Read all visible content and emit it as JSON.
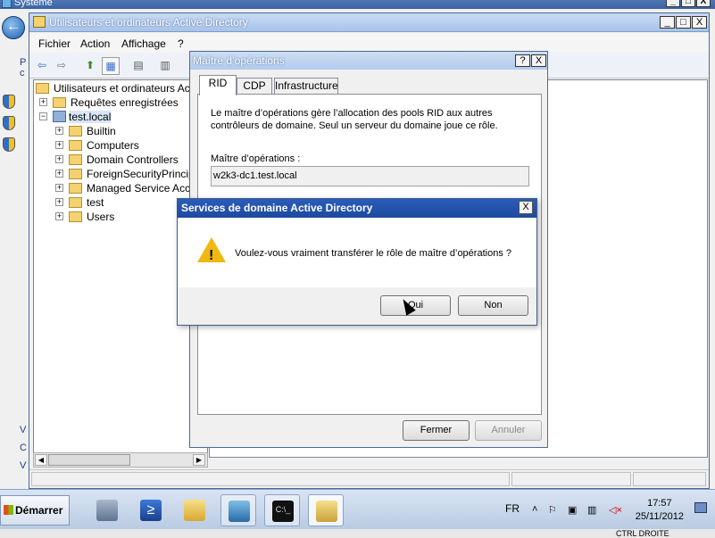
{
  "background_window": {
    "title": "Système",
    "side_chars": [
      "P",
      "c",
      "V",
      "C",
      "V"
    ],
    "controls": [
      "_",
      "□",
      "X"
    ]
  },
  "aduc": {
    "title": "Utilisateurs et ordinateurs Active Directory",
    "controls": [
      "_",
      "□",
      "X"
    ],
    "menu": [
      "Fichier",
      "Action",
      "Affichage",
      "?"
    ],
    "tree": {
      "root": "Utilisateurs et ordinateurs Active",
      "saved": "Requêtes enregistrées",
      "domain": "test.local",
      "children": [
        "Builtin",
        "Computers",
        "Domain Controllers",
        "ForeignSecurityPrincipal",
        "Managed Service Accou",
        "test",
        "Users"
      ]
    }
  },
  "properties": {
    "title": "Maître d’opérations",
    "help_btn": "?",
    "close_btn": "X",
    "tabs": [
      "RID",
      "CDP",
      "Infrastructure"
    ],
    "active_tab": "RID",
    "description": "Le maître d’opérations gère l’allocation des pools RID aux autres contrôleurs de domaine. Seul un serveur du domaine joue ce rôle.",
    "om_label": "Maître d’opérations :",
    "om_value": "w2k3-dc1.test.local",
    "close_button": "Fermer",
    "cancel_button": "Annuler"
  },
  "confirm": {
    "title": "Services de domaine Active Directory",
    "close": "X",
    "message": "Voulez-vous vraiment transférer le rôle de maître d’opérations ?",
    "yes": "Oui",
    "no": "Non"
  },
  "taskbar": {
    "start": "Démarrer",
    "lang": "FR",
    "time": "17:57",
    "date": "25/11/2012",
    "apps": [
      "server-manager",
      "powershell",
      "explorer",
      "network-console",
      "command-prompt",
      "active-directory-tool"
    ],
    "bottom_text": "CTRL DROITE"
  }
}
